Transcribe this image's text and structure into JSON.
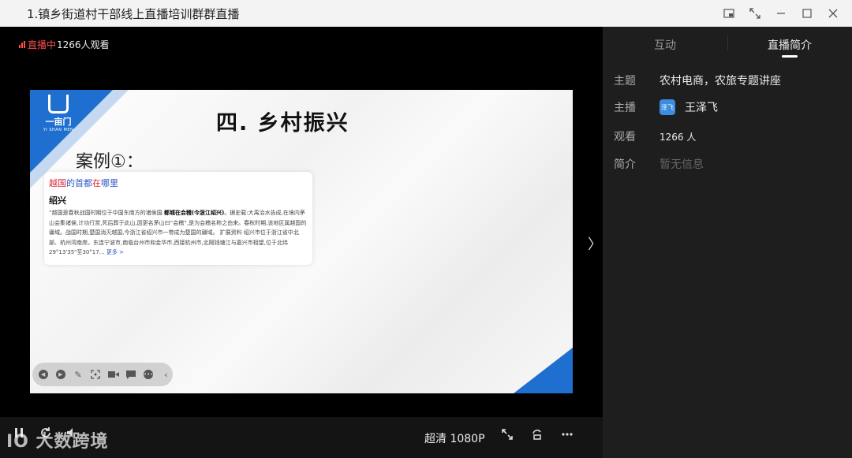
{
  "window": {
    "title": "1.镇乡街道村干部线上直播培训群群直播"
  },
  "player": {
    "live_label": "直播中",
    "viewer_count": "1266人观看",
    "quality": "超清 1080P",
    "live_color": "#ff4b4b"
  },
  "slide": {
    "title": "四.  乡村振兴",
    "case_label": "案例①：",
    "logo_text": "一亩门",
    "logo_sub": "YI SHAN MEN",
    "card": {
      "question_1": "越国",
      "question_2": "的首都",
      "question_3": "在",
      "question_4": "哪里",
      "heading": "绍兴",
      "body_1": "“越国是春秋战国时期位于中国东南方的诸侯国.",
      "body_bold": "都城在会稽(今浙江绍兴)",
      "body_2": "。据史载:大禹治水告成,在境内茅山会集诸侯,计功行赏,死后葬于此山,因更名茅山曰“会稽”,是为会稽名称之由来。春秋时期,该地区属越国的疆域。战国时期,楚国消灭越国,今浙江省绍兴市一带成为楚国的疆域。 扩展资料 绍兴市位于浙江省中北部、杭州湾南岸。东连宁波市,南临台州市和金华市,西接杭州市,北隔钱塘江与嘉兴市相望,位于北纬29°13'35\"至30°17…",
      "more": "更多 >"
    }
  },
  "sidepanel": {
    "tabs": [
      "互动",
      "直播简介"
    ],
    "rows": {
      "topic_key": "主题",
      "topic_value": "农村电商，农旅专题讲座",
      "host_key": "主播",
      "host_avatar": "泽飞",
      "host_value": "王泽飞",
      "views_key": "观看",
      "views_value": "1266 人",
      "intro_key": "简介",
      "intro_value": "暂无信息"
    }
  },
  "watermark": "IO 大数跨境",
  "colors": {
    "accent_blue": "#1f6fd0",
    "panel_bg": "#1e1e1e"
  }
}
